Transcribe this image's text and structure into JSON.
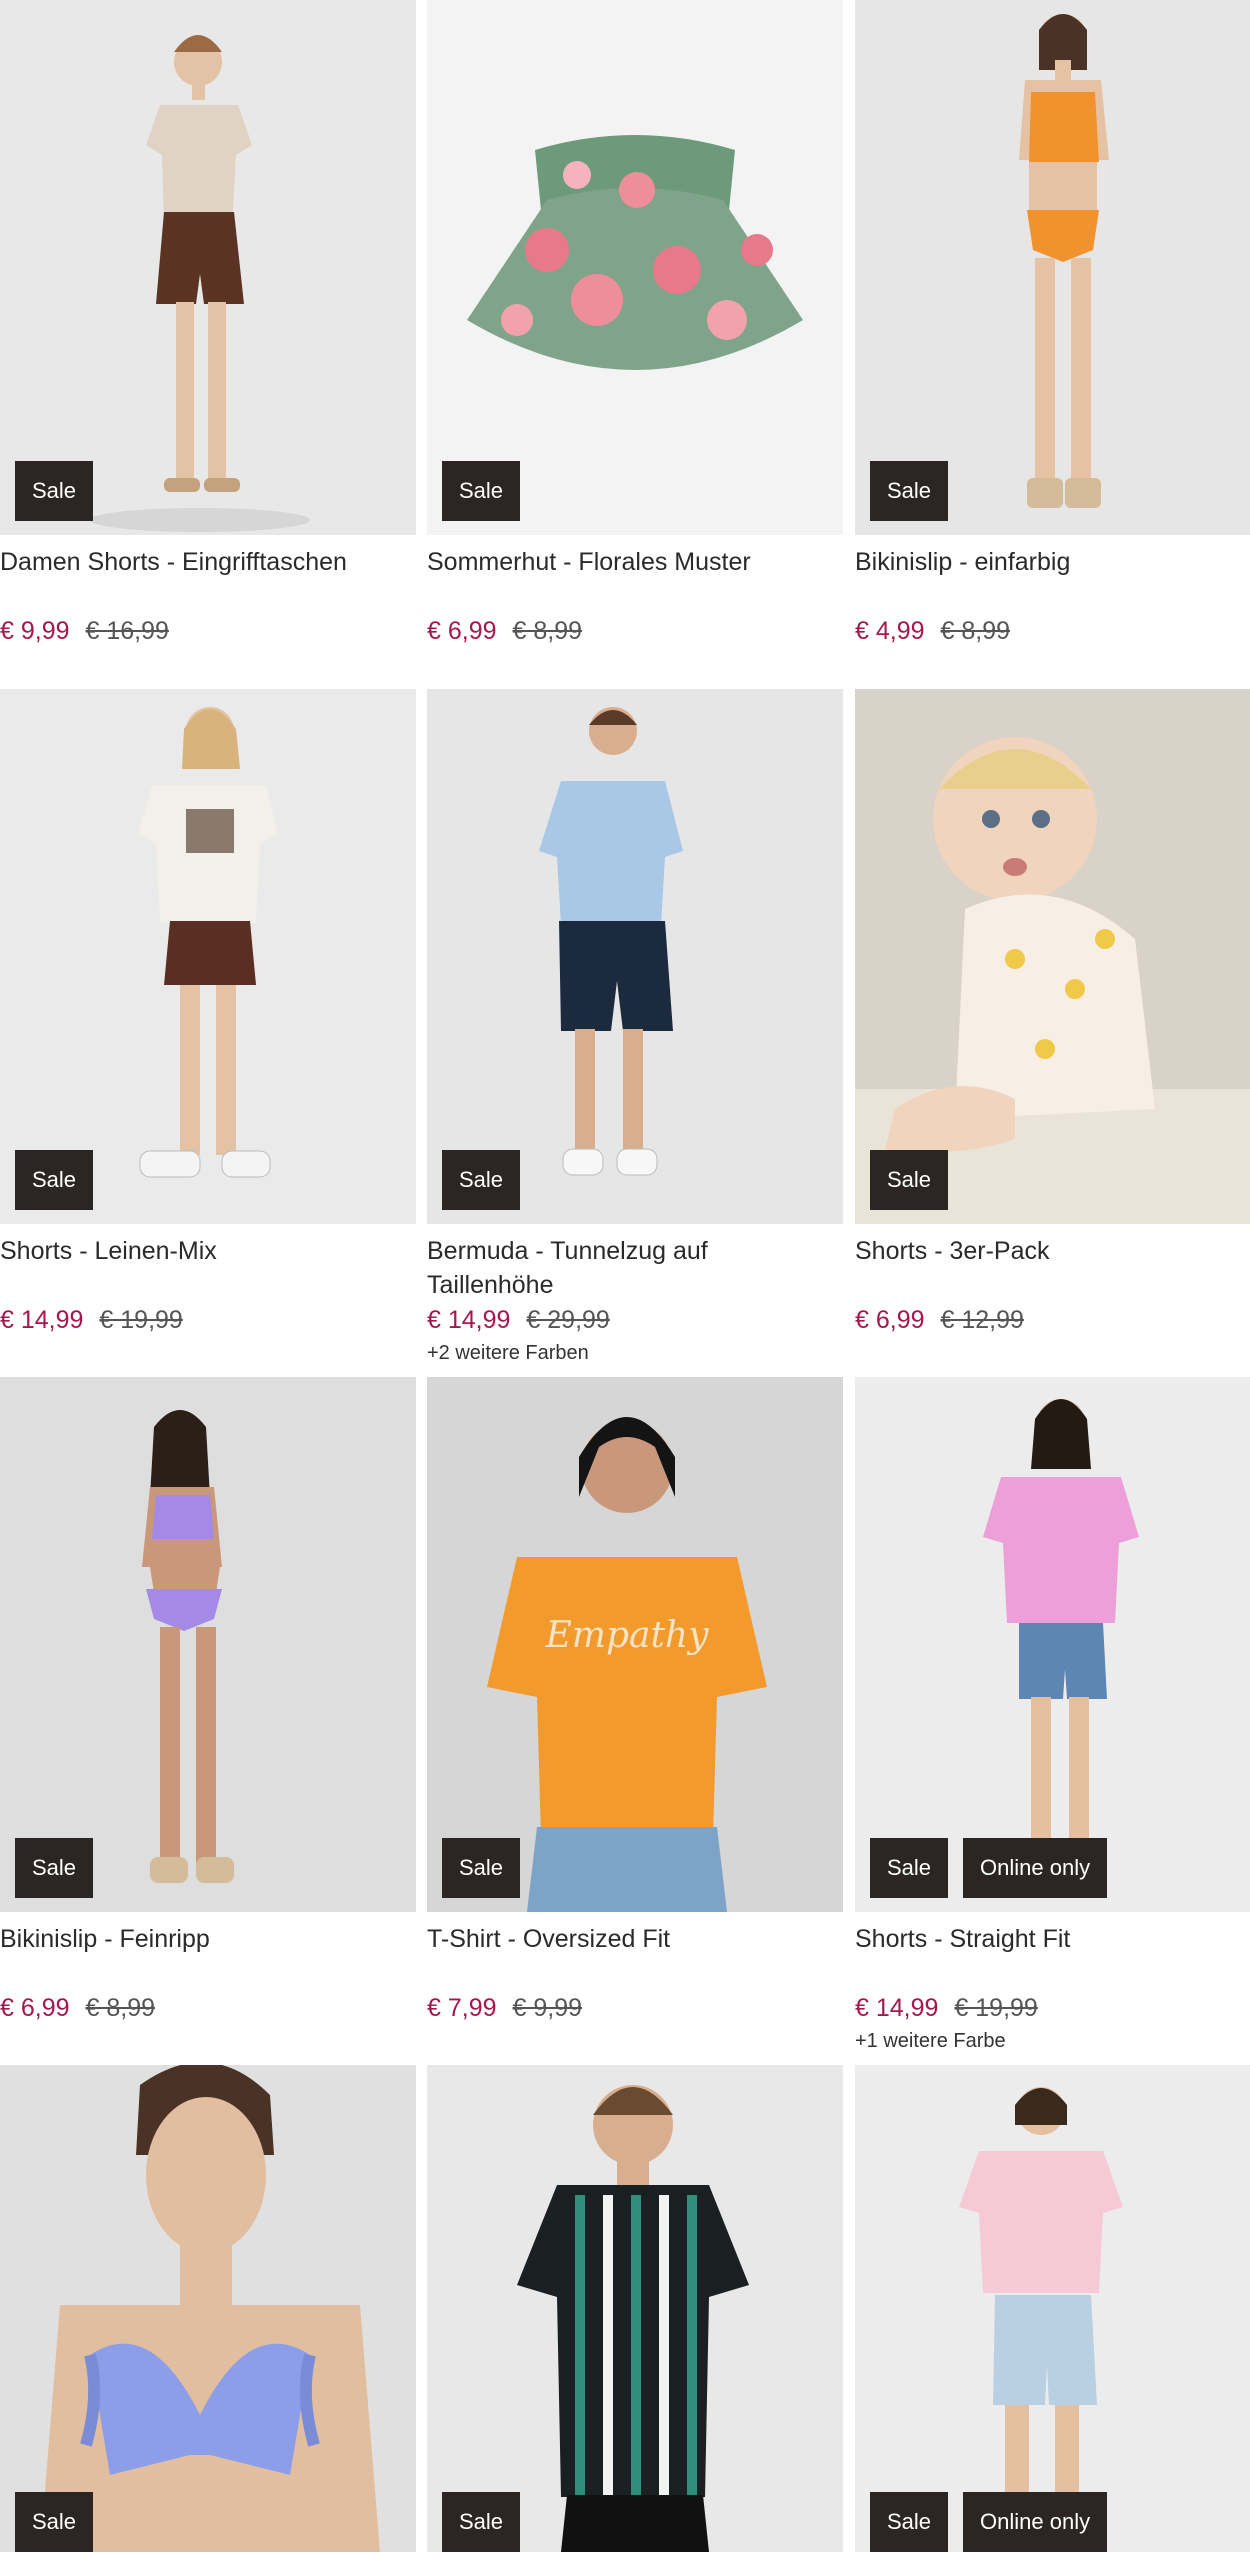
{
  "products": [
    {
      "title": "Damen Shorts - Eingrifftaschen",
      "price": "€ 9,99",
      "old_price": "€ 16,99",
      "badges": [
        "Sale"
      ],
      "colors_note": "",
      "image": "woman-shorts-beige-shirt"
    },
    {
      "title": "Sommerhut - Florales Muster",
      "price": "€ 6,99",
      "old_price": "€ 8,99",
      "badges": [
        "Sale"
      ],
      "colors_note": "",
      "image": "floral-bucket-hat"
    },
    {
      "title": "Bikinislip - einfarbig",
      "price": "€ 4,99",
      "old_price": "€ 8,99",
      "badges": [
        "Sale"
      ],
      "colors_note": "",
      "image": "orange-bikini"
    },
    {
      "title": "Shorts - Leinen-Mix",
      "price": "€ 14,99",
      "old_price": "€ 19,99",
      "badges": [
        "Sale"
      ],
      "colors_note": "",
      "image": "woman-brown-shorts"
    },
    {
      "title": "Bermuda - Tunnelzug auf Taillenhöhe",
      "price": "€ 14,99",
      "old_price": "€ 29,99",
      "badges": [
        "Sale"
      ],
      "colors_note": "+2 weitere Farben",
      "image": "man-bermuda"
    },
    {
      "title": "Shorts - 3er-Pack",
      "price": "€ 6,99",
      "old_price": "€ 12,99",
      "badges": [
        "Sale"
      ],
      "colors_note": "",
      "image": "baby-shorts"
    },
    {
      "title": "Bikinislip - Feinripp",
      "price": "€ 6,99",
      "old_price": "€ 8,99",
      "badges": [
        "Sale"
      ],
      "colors_note": "",
      "image": "lilac-bikini"
    },
    {
      "title": "T-Shirt - Oversized Fit",
      "price": "€ 7,99",
      "old_price": "€ 9,99",
      "badges": [
        "Sale"
      ],
      "colors_note": "",
      "image": "orange-tshirt"
    },
    {
      "title": "Shorts - Straight Fit",
      "price": "€ 14,99",
      "old_price": "€ 19,99",
      "badges": [
        "Sale",
        "Online only"
      ],
      "colors_note": "+1 weitere Farbe",
      "image": "woman-denim-shorts"
    },
    {
      "title": "",
      "price": "",
      "old_price": "",
      "badges": [
        "Sale"
      ],
      "colors_note": "",
      "image": "blue-ruffle-bikini"
    },
    {
      "title": "",
      "price": "",
      "old_price": "",
      "badges": [
        "Sale"
      ],
      "colors_note": "",
      "image": "striped-tshirt"
    },
    {
      "title": "",
      "price": "",
      "old_price": "",
      "badges": [
        "Sale",
        "Online only"
      ],
      "colors_note": "",
      "image": "pink-tshirt-shorts"
    }
  ],
  "colors": {
    "price": "#a6174f",
    "badge_bg": "#2b2624"
  }
}
